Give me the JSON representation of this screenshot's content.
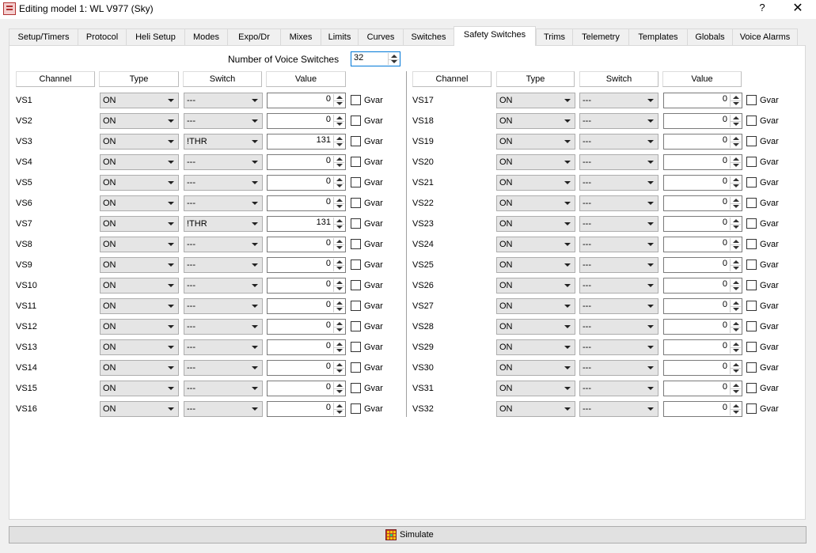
{
  "window": {
    "title": "Editing model 1: WL V977 (Sky)",
    "help": "?",
    "close": "✕"
  },
  "tabs": [
    "Setup/Timers",
    "Protocol",
    "Heli Setup",
    "Modes",
    "Expo/Dr",
    "Mixes",
    "Limits",
    "Curves",
    "Switches",
    "Safety Switches",
    "Trims",
    "Telemetry",
    "Templates",
    "Globals",
    "Voice Alarms"
  ],
  "active_tab": "Safety Switches",
  "voice_switches": {
    "label": "Number of Voice Switches",
    "value": "32"
  },
  "columns": [
    "Channel",
    "Type",
    "Switch",
    "Value"
  ],
  "gvar_label": "Gvar",
  "rows": [
    {
      "channel": "VS1",
      "type": "ON",
      "switch": "---",
      "value": "0"
    },
    {
      "channel": "VS2",
      "type": "ON",
      "switch": "---",
      "value": "0"
    },
    {
      "channel": "VS3",
      "type": "ON",
      "switch": "!THR",
      "value": "131"
    },
    {
      "channel": "VS4",
      "type": "ON",
      "switch": "---",
      "value": "0"
    },
    {
      "channel": "VS5",
      "type": "ON",
      "switch": "---",
      "value": "0"
    },
    {
      "channel": "VS6",
      "type": "ON",
      "switch": "---",
      "value": "0"
    },
    {
      "channel": "VS7",
      "type": "ON",
      "switch": "!THR",
      "value": "131"
    },
    {
      "channel": "VS8",
      "type": "ON",
      "switch": "---",
      "value": "0"
    },
    {
      "channel": "VS9",
      "type": "ON",
      "switch": "---",
      "value": "0"
    },
    {
      "channel": "VS10",
      "type": "ON",
      "switch": "---",
      "value": "0"
    },
    {
      "channel": "VS11",
      "type": "ON",
      "switch": "---",
      "value": "0"
    },
    {
      "channel": "VS12",
      "type": "ON",
      "switch": "---",
      "value": "0"
    },
    {
      "channel": "VS13",
      "type": "ON",
      "switch": "---",
      "value": "0"
    },
    {
      "channel": "VS14",
      "type": "ON",
      "switch": "---",
      "value": "0"
    },
    {
      "channel": "VS15",
      "type": "ON",
      "switch": "---",
      "value": "0"
    },
    {
      "channel": "VS16",
      "type": "ON",
      "switch": "---",
      "value": "0"
    },
    {
      "channel": "VS17",
      "type": "ON",
      "switch": "---",
      "value": "0"
    },
    {
      "channel": "VS18",
      "type": "ON",
      "switch": "---",
      "value": "0"
    },
    {
      "channel": "VS19",
      "type": "ON",
      "switch": "---",
      "value": "0"
    },
    {
      "channel": "VS20",
      "type": "ON",
      "switch": "---",
      "value": "0"
    },
    {
      "channel": "VS21",
      "type": "ON",
      "switch": "---",
      "value": "0"
    },
    {
      "channel": "VS22",
      "type": "ON",
      "switch": "---",
      "value": "0"
    },
    {
      "channel": "VS23",
      "type": "ON",
      "switch": "---",
      "value": "0"
    },
    {
      "channel": "VS24",
      "type": "ON",
      "switch": "---",
      "value": "0"
    },
    {
      "channel": "VS25",
      "type": "ON",
      "switch": "---",
      "value": "0"
    },
    {
      "channel": "VS26",
      "type": "ON",
      "switch": "---",
      "value": "0"
    },
    {
      "channel": "VS27",
      "type": "ON",
      "switch": "---",
      "value": "0"
    },
    {
      "channel": "VS28",
      "type": "ON",
      "switch": "---",
      "value": "0"
    },
    {
      "channel": "VS29",
      "type": "ON",
      "switch": "---",
      "value": "0"
    },
    {
      "channel": "VS30",
      "type": "ON",
      "switch": "---",
      "value": "0"
    },
    {
      "channel": "VS31",
      "type": "ON",
      "switch": "---",
      "value": "0"
    },
    {
      "channel": "VS32",
      "type": "ON",
      "switch": "---",
      "value": "0"
    }
  ],
  "simulate": {
    "label": "Simulate",
    "icon": "simulator-icon"
  },
  "colors": {
    "accent": "#0078d7",
    "panel": "#ffffff",
    "background": "#f0f0f0"
  }
}
